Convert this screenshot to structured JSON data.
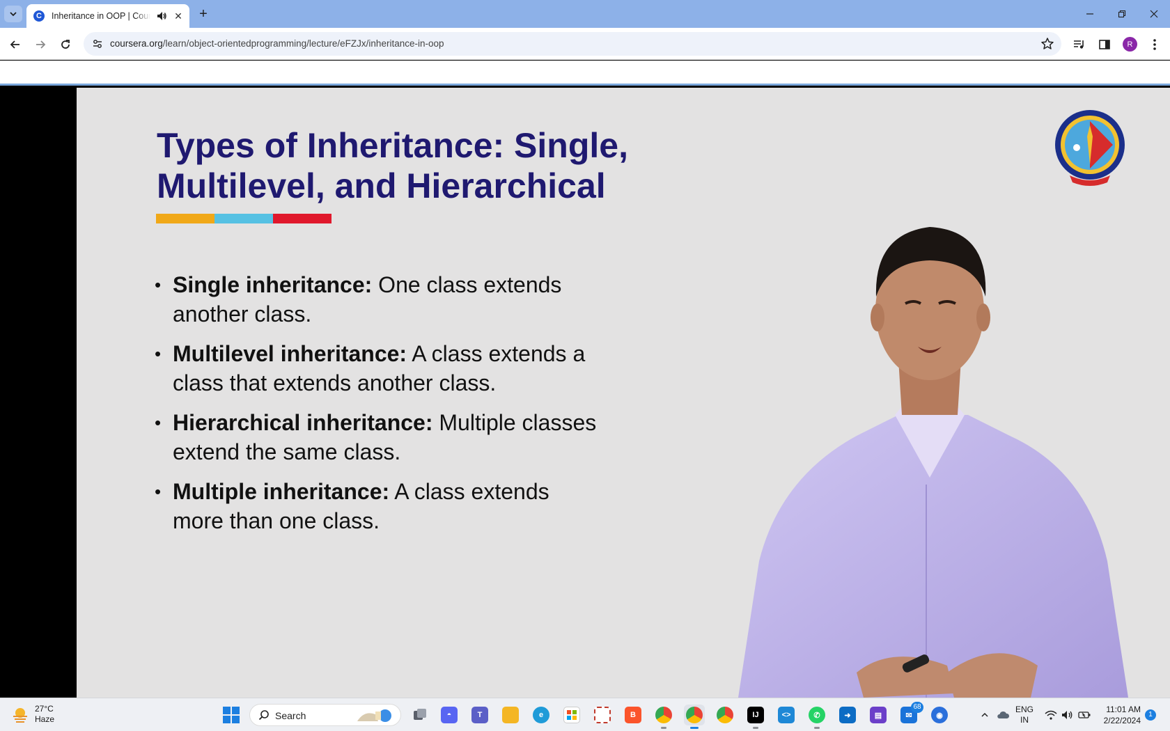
{
  "browser": {
    "tab": {
      "title": "Inheritance in OOP | Coursera",
      "favicon_letter": "C"
    },
    "new_tab_label": "+",
    "close_glyph": "✕",
    "address": {
      "host": "coursera.org",
      "path": "/learn/object-orientedprogramming/lecture/eFZJx/inheritance-in-oop"
    },
    "profile_initial": "R"
  },
  "slide": {
    "title": "Types of Inheritance: Single, Multilevel, and Hierarchical",
    "accent_colors": [
      "#f0a818",
      "#56c1e3",
      "#e0182c"
    ],
    "bullets": [
      {
        "term": "Single inheritance:",
        "desc": " One class extends another class."
      },
      {
        "term": "Multilevel inheritance:",
        "desc": " A class extends a class that extends another class."
      },
      {
        "term": "Hierarchical inheritance:",
        "desc": " Multiple classes extend the same class."
      },
      {
        "term": "Multiple inheritance:",
        "desc": " A class extends more than one class."
      }
    ]
  },
  "taskbar": {
    "weather": {
      "temp": "27°C",
      "condition": "Haze"
    },
    "search_placeholder": "Search",
    "mail_badge": "68",
    "language": {
      "line1": "ENG",
      "line2": "IN"
    },
    "clock": {
      "time": "11:01 AM",
      "date": "2/22/2024"
    },
    "notification_count": "1"
  },
  "colors": {
    "tabstrip": "#8db1e8",
    "slide_title": "#1f1970",
    "slide_bg": "#e3e2e2",
    "accent": "#1c7fe0"
  }
}
